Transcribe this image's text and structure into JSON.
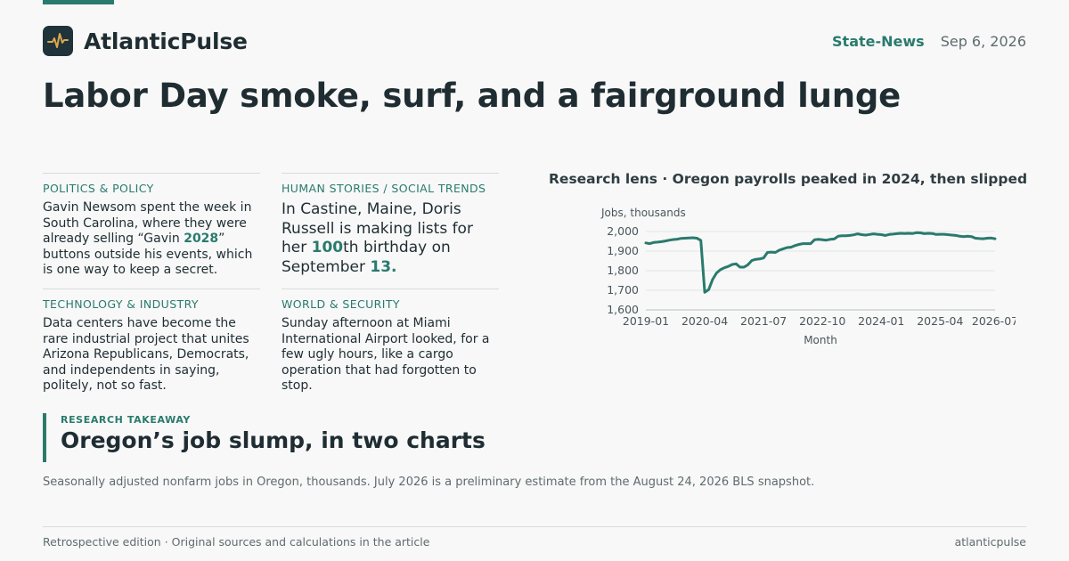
{
  "brand": {
    "name": "AtlanticPulse",
    "logo_icon": "pulse-icon",
    "accent": "#2a7a6e"
  },
  "header": {
    "section": "State-News",
    "date": "Sep 6, 2026"
  },
  "headline": "Labor Day smoke, surf, and a fairground lunge",
  "stories": [
    {
      "kicker": "POLITICS & POLICY",
      "parts": [
        "Gavin Newsom spent the week in South Carolina, where they were already selling “Gavin ",
        "2028",
        "” buttons outside his events, which is one way to keep a secret."
      ]
    },
    {
      "kicker": "HUMAN STORIES / SOCIAL TRENDS",
      "parts": [
        "In Castine, Maine, Doris Russell is making lists for her ",
        "100",
        "th birthday on September ",
        "13.",
        ""
      ]
    },
    {
      "kicker": "TECHNOLOGY & INDUSTRY",
      "parts": [
        "Data centers have become the rare industrial project that unites Arizona Republicans, Democrats, and independents in saying, politely, not so fast."
      ]
    },
    {
      "kicker": "WORLD & SECURITY",
      "parts": [
        "Sunday afternoon at Miami International Airport looked, for a few ugly hours, like a cargo operation that had forgotten to stop."
      ]
    }
  ],
  "chart_title": "Research lens · Oregon payrolls peaked in 2024, then slipped",
  "chart_data": {
    "type": "line",
    "title": "Research lens · Oregon payrolls peaked in 2024, then slipped",
    "xlabel": "Month",
    "ylabel": "Jobs, thousands",
    "ylim": [
      1600,
      2000
    ],
    "yticks": [
      "1,600",
      "1,700",
      "1,800",
      "1,900",
      "2,000"
    ],
    "ytick_values": [
      1600,
      1700,
      1800,
      1900,
      2000
    ],
    "xticks": [
      "2019-01",
      "2020-04",
      "2021-07",
      "2022-10",
      "2024-01",
      "2025-04",
      "2026-07"
    ],
    "grid": true,
    "color": "#2a7a6e",
    "series": [
      {
        "values": [
          1942,
          1938,
          1944,
          1946,
          1948,
          1952,
          1956,
          1959,
          1961,
          1965,
          1966,
          1967,
          1968,
          1966,
          1955,
          1690,
          1703,
          1755,
          1788,
          1805,
          1815,
          1822,
          1832,
          1835,
          1818,
          1818,
          1830,
          1852,
          1858,
          1860,
          1865,
          1893,
          1895,
          1893,
          1905,
          1912,
          1918,
          1920,
          1928,
          1934,
          1938,
          1938,
          1938,
          1958,
          1960,
          1958,
          1956,
          1960,
          1962,
          1976,
          1978,
          1978,
          1980,
          1983,
          1988,
          1984,
          1982,
          1985,
          1988,
          1986,
          1984,
          1980,
          1985,
          1987,
          1989,
          1991,
          1990,
          1991,
          1990,
          1994,
          1993,
          1989,
          1991,
          1990,
          1985,
          1986,
          1986,
          1984,
          1982,
          1980,
          1976,
          1974,
          1976,
          1974,
          1966,
          1964,
          1963,
          1966,
          1967,
          1963
        ]
      }
    ]
  },
  "takeaway": {
    "label": "RESEARCH TAKEAWAY",
    "headline": "Oregon’s job slump, in two charts"
  },
  "note": "Seasonally adjusted nonfarm jobs in Oregon, thousands. July 2026 is a preliminary estimate from the August 24, 2026 BLS snapshot.",
  "footer": {
    "left": "Retrospective edition · Original sources and calculations in the article",
    "right": "atlanticpulse"
  }
}
